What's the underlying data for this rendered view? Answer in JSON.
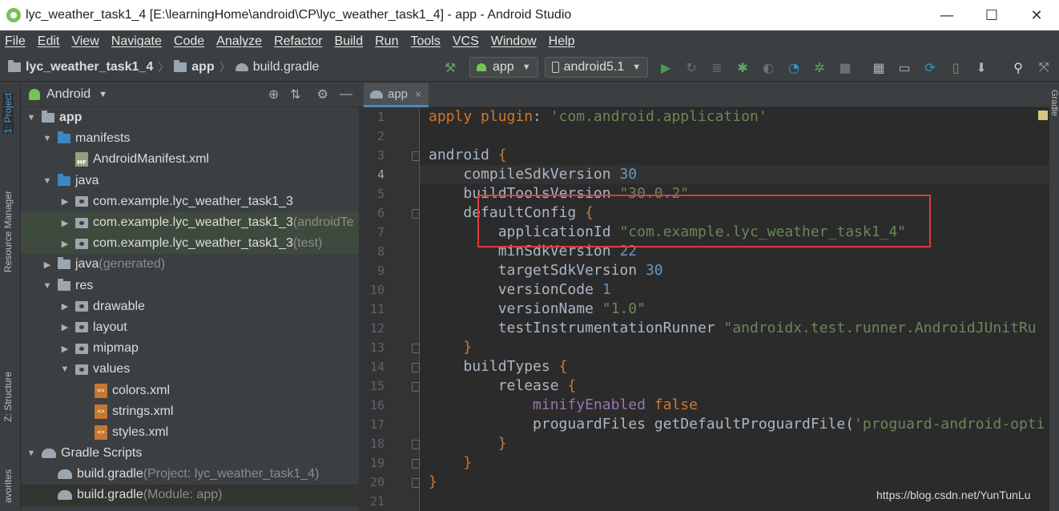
{
  "window": {
    "title": "lyc_weather_task1_4 [E:\\learningHome\\android\\CP\\lyc_weather_task1_4] - app - Android Studio",
    "minimize": "—",
    "maximize": "☐",
    "close": "✕"
  },
  "menu": [
    "File",
    "Edit",
    "View",
    "Navigate",
    "Code",
    "Analyze",
    "Refactor",
    "Build",
    "Run",
    "Tools",
    "VCS",
    "Window",
    "Help"
  ],
  "breadcrumb": [
    "lyc_weather_task1_4",
    "app",
    "build.gradle"
  ],
  "toolbar": {
    "run_config": "app",
    "device": "android5.1"
  },
  "left_tools": {
    "project": "1: Project",
    "resource_manager": "Resource Manager",
    "structure": "Z: Structure",
    "favorites": "avorites"
  },
  "project_panel": {
    "view_mode": "Android",
    "tree": [
      {
        "label": "app",
        "suffix": ""
      },
      {
        "label": "manifests",
        "suffix": ""
      },
      {
        "label": "AndroidManifest.xml",
        "suffix": ""
      },
      {
        "label": "java",
        "suffix": ""
      },
      {
        "label": "com.example.lyc_weather_task1_3",
        "suffix": ""
      },
      {
        "label": "com.example.lyc_weather_task1_3",
        "suffix": " (androidTe"
      },
      {
        "label": "com.example.lyc_weather_task1_3",
        "suffix": " (test)"
      },
      {
        "label": "java",
        "suffix": " (generated)"
      },
      {
        "label": "res",
        "suffix": ""
      },
      {
        "label": "drawable",
        "suffix": ""
      },
      {
        "label": "layout",
        "suffix": ""
      },
      {
        "label": "mipmap",
        "suffix": ""
      },
      {
        "label": "values",
        "suffix": ""
      },
      {
        "label": "colors.xml",
        "suffix": ""
      },
      {
        "label": "strings.xml",
        "suffix": ""
      },
      {
        "label": "styles.xml",
        "suffix": ""
      },
      {
        "label": "Gradle Scripts",
        "suffix": ""
      },
      {
        "label": "build.gradle",
        "suffix": " (Project: lyc_weather_task1_4)"
      },
      {
        "label": "build.gradle",
        "suffix": " (Module: app)"
      }
    ]
  },
  "editor": {
    "tab": "app",
    "line_numbers": [
      "1",
      "2",
      "3",
      "4",
      "5",
      "6",
      "7",
      "8",
      "9",
      "10",
      "11",
      "12",
      "13",
      "14",
      "15",
      "16",
      "17",
      "18",
      "19",
      "20",
      "21"
    ],
    "code": {
      "l1_kw": "apply plugin",
      "l1_str": "'com.android.application'",
      "l3": "android",
      "l4_prop": "compileSdkVersion",
      "l4_val": "30",
      "l5_prop": "buildToolsVersion",
      "l5_val": "\"30.0.2\"",
      "l6": "defaultConfig",
      "l7_prop": "applicationId",
      "l7_val": "\"com.example.lyc_weather_task1_4\"",
      "l8_prop": "minSdkVersion",
      "l8_val": "22",
      "l9_prop": "targetSdkVersion",
      "l9_val": "30",
      "l10_prop": "versionCode",
      "l10_val": "1",
      "l11_prop": "versionName",
      "l11_val": "\"1.0\"",
      "l12_prop": "testInstrumentationRunner",
      "l12_val": "\"androidx.test.runner.AndroidJUnitRu",
      "l14": "buildTypes",
      "l15": "release",
      "l16_prop": "minifyEnabled",
      "l16_val": "false",
      "l17_prop": "proguardFiles",
      "l17_fn": "getDefaultProguardFile",
      "l17_str": "'proguard-android-opti"
    }
  },
  "right_tools": {
    "gradle": "Gradle"
  },
  "watermark": "https://blog.csdn.net/YunTunLu"
}
